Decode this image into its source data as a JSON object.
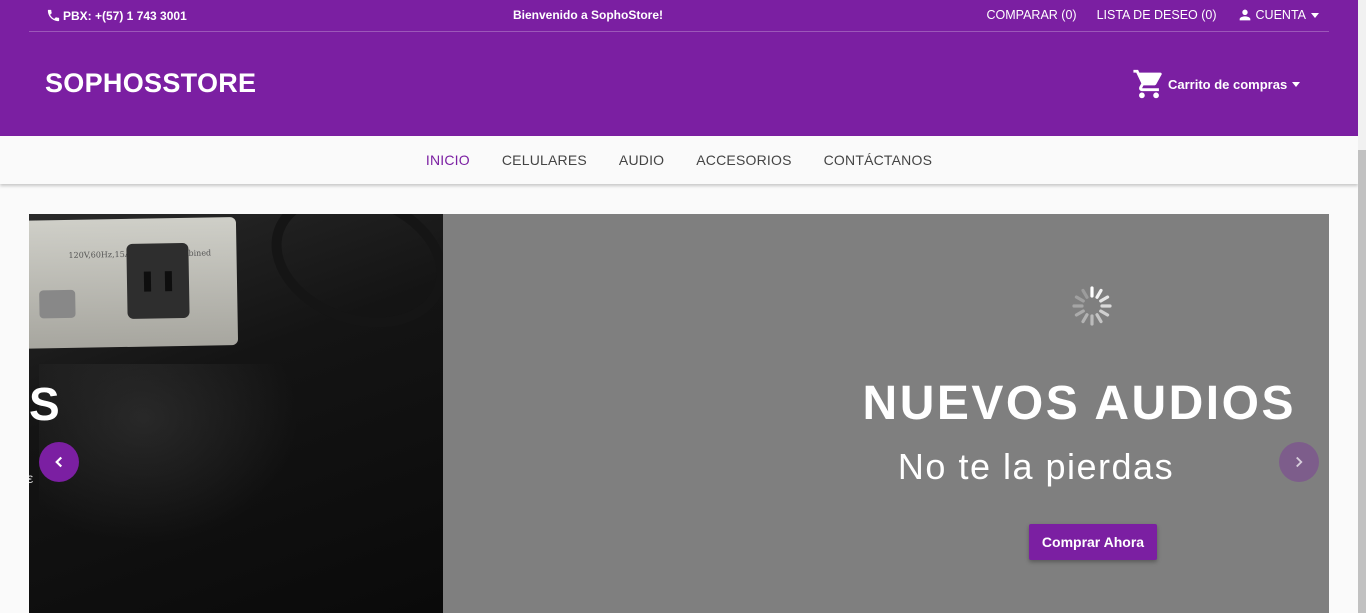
{
  "topbar": {
    "pbx": "PBX: +(57) 1 743 3001",
    "welcome": "Bienvenido a SophoStore!",
    "compare": "COMPARAR (0)",
    "wishlist": "LISTA DE DESEO (0)",
    "account": "CUENTA"
  },
  "header": {
    "brand": "SOPHOSSTORE",
    "cart": "Carrito de compras"
  },
  "nav": {
    "items": [
      {
        "label": "INICIO",
        "active": true
      },
      {
        "label": "CELULARES"
      },
      {
        "label": "AUDIO"
      },
      {
        "label": "ACCESORIOS"
      },
      {
        "label": "CONTÁCTANOS"
      }
    ]
  },
  "carousel": {
    "prev_slide_title": "S",
    "prev_slide_partial": "ε",
    "powerstrip_label": "120V,60Hz,15Amps Max.Combined",
    "slide_title": "NUEVOS AUDIOS",
    "slide_subtitle": "No te la pierdas",
    "cta": "Comprar Ahora"
  },
  "colors": {
    "primary": "#7b1fa2",
    "slide_bg": "#7f7f7f",
    "nav_bg": "#fafafa"
  },
  "icons": [
    "phone-icon",
    "account-icon",
    "cart-icon",
    "chevron-left-icon",
    "chevron-right-icon",
    "loading-spinner-icon"
  ]
}
